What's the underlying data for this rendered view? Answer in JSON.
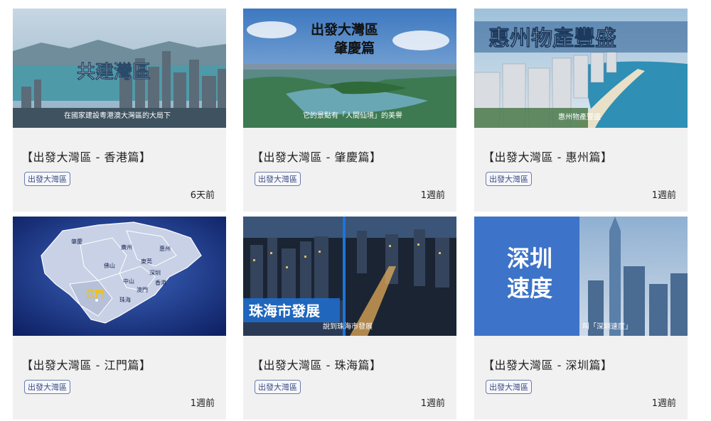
{
  "cards": [
    {
      "title": "【出發大灣區 - 香港篇】",
      "tag": "出發大灣區",
      "time": "6天前",
      "thumb_headline": "共建灣區",
      "thumb_caption": "在國家建設粵港澳大灣區的大局下"
    },
    {
      "title": "【出發大灣區 - 肇慶篇】",
      "tag": "出發大灣區",
      "time": "1週前",
      "thumb_headline_1": "出發大灣區",
      "thumb_headline_2": "肇慶篇",
      "thumb_caption": "它的景點有「人間仙境」的美譽"
    },
    {
      "title": "【出發大灣區 - 惠州篇】",
      "tag": "出發大灣區",
      "time": "1週前",
      "thumb_headline": "惠州物產豐盛",
      "thumb_caption": "惠州物產豐盛"
    },
    {
      "title": "【出發大灣區 - 江門篇】",
      "tag": "出發大灣區",
      "time": "1週前",
      "map_labels": [
        "肇慶",
        "廣州",
        "惠州",
        "佛山",
        "東莞",
        "深圳",
        "中山",
        "澳門",
        "香港",
        "江門",
        "珠海"
      ]
    },
    {
      "title": "【出發大灣區 - 珠海篇】",
      "tag": "出發大灣區",
      "time": "1週前",
      "thumb_headline": "珠海市發展",
      "thumb_caption": "說到珠海市發展"
    },
    {
      "title": "【出發大灣區 - 深圳篇】",
      "tag": "出發大灣區",
      "time": "1週前",
      "thumb_headline_1": "深圳",
      "thumb_headline_2": "速度",
      "thumb_caption": "叫「深圳速度」"
    }
  ]
}
